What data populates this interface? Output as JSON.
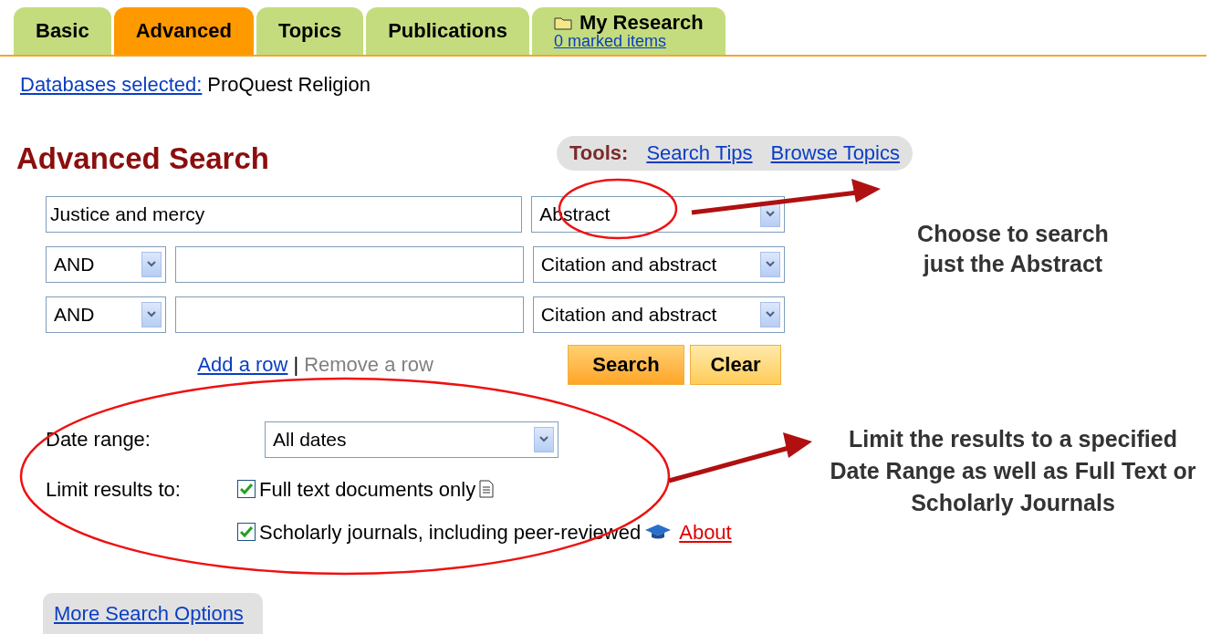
{
  "tabs": [
    {
      "label": "Basic",
      "selected": false
    },
    {
      "label": "Advanced",
      "selected": true
    },
    {
      "label": "Topics",
      "selected": false
    },
    {
      "label": "Publications",
      "selected": false
    },
    {
      "label": "My Research",
      "sublabel": "0 marked items",
      "selected": false
    }
  ],
  "databases": {
    "link": "Databases selected:",
    "value": "ProQuest Religion"
  },
  "heading": "Advanced Search",
  "tools": {
    "label": "Tools:",
    "links": [
      "Search Tips",
      "Browse Topics"
    ]
  },
  "rows": [
    {
      "value": "Justice and mercy",
      "field": "Abstract"
    },
    {
      "operator": "AND",
      "value": "",
      "field": "Citation and abstract"
    },
    {
      "operator": "AND",
      "value": "",
      "field": "Citation and abstract"
    }
  ],
  "row_links": {
    "add": "Add a row",
    "separator": "|",
    "remove": "Remove a row"
  },
  "buttons": [
    "Search",
    "Clear"
  ],
  "date_range": {
    "label": "Date range:",
    "value": "All dates"
  },
  "limits": {
    "label": "Limit results to:",
    "options": [
      {
        "label": "Full text documents only",
        "checked": true,
        "kind": "document"
      },
      {
        "label": "Scholarly journals, including peer-reviewed",
        "checked": true,
        "kind": "scholarly",
        "link": "About"
      }
    ]
  },
  "more_options": "More Search Options",
  "annotations": [
    "Choose to search just the Abstract",
    "Limit the results to a specified Date Range as well as Full Text or Scholarly Journals"
  ]
}
